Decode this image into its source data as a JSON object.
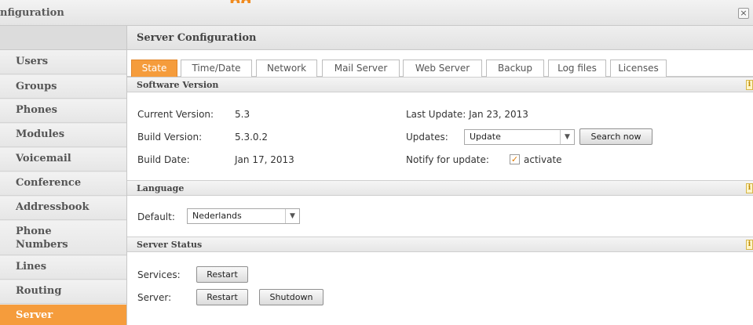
{
  "window": {
    "title": "nfiguration",
    "accent_text": "pg",
    "close_label": "×"
  },
  "sidebar": {
    "items": [
      {
        "label": "Users"
      },
      {
        "label": "Groups"
      },
      {
        "label": "Phones"
      },
      {
        "label": "Modules"
      },
      {
        "label": "Voicemail"
      },
      {
        "label": "Conference"
      },
      {
        "label": "Addressbook"
      },
      {
        "label": "Phone Numbers"
      },
      {
        "label": "Lines"
      },
      {
        "label": "Routing"
      },
      {
        "label": "Server"
      }
    ],
    "active": "Server"
  },
  "main": {
    "header": "Server Configuration",
    "tabs": [
      "State",
      "Time/Date",
      "Network",
      "Mail Server",
      "Web Server",
      "Backup",
      "Log files",
      "Licenses"
    ],
    "active_tab": "State"
  },
  "software": {
    "title": "Software Version",
    "current_version_label": "Current Version:",
    "current_version": "5.3",
    "build_version_label": "Build Version:",
    "build_version": "5.3.0.2",
    "build_date_label": "Build Date:",
    "build_date": "Jan 17, 2013",
    "last_update": "Last Update: Jan 23, 2013",
    "updates_label": "Updates:",
    "updates_value": "Update",
    "search_button": "Search now",
    "notify_label": "Notify for update:",
    "notify_checked": true,
    "notify_option": "activate"
  },
  "language": {
    "title": "Language",
    "default_label": "Default:",
    "default_value": "Nederlands"
  },
  "server_status": {
    "title": "Server Status",
    "services_label": "Services:",
    "services_restart": "Restart",
    "server_label": "Server:",
    "server_restart": "Restart",
    "server_shutdown": "Shutdown"
  },
  "colors": {
    "accent": "#f59c3c",
    "info_icon": "#d7b74a"
  },
  "icons": {
    "close": "close-icon",
    "info": "info-icon",
    "dropdown": "chevron-down-icon",
    "check": "check-icon"
  }
}
